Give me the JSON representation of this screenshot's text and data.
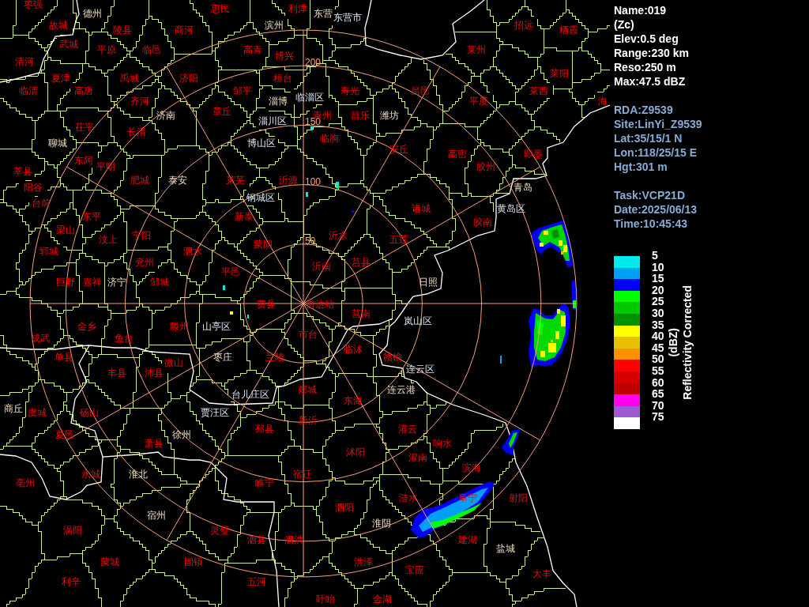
{
  "map": {
    "range_labels": [
      "200",
      "150",
      "100",
      "50"
    ],
    "places": [
      {
        "name": "枣强",
        "kind": "county"
      },
      {
        "name": "惠民",
        "kind": "county"
      },
      {
        "name": "利津",
        "kind": "county"
      },
      {
        "name": "德州",
        "kind": "city"
      },
      {
        "name": "东营",
        "kind": "city"
      },
      {
        "name": "东营市",
        "kind": "district"
      },
      {
        "name": "故城",
        "kind": "county"
      },
      {
        "name": "滨州",
        "kind": "city"
      },
      {
        "name": "招远",
        "kind": "county"
      },
      {
        "name": "陵县",
        "kind": "county"
      },
      {
        "name": "商河",
        "kind": "county"
      },
      {
        "name": "栖霞",
        "kind": "county"
      },
      {
        "name": "武城",
        "kind": "county"
      },
      {
        "name": "平原",
        "kind": "county"
      },
      {
        "name": "临邑",
        "kind": "county"
      },
      {
        "name": "高青",
        "kind": "county"
      },
      {
        "name": "莱州",
        "kind": "county"
      },
      {
        "name": "博兴",
        "kind": "county"
      },
      {
        "name": "清河",
        "kind": "county"
      },
      {
        "name": "莱阳",
        "kind": "county"
      },
      {
        "name": "夏津",
        "kind": "county"
      },
      {
        "name": "禹城",
        "kind": "county"
      },
      {
        "name": "济阳",
        "kind": "county"
      },
      {
        "name": "桓台",
        "kind": "county"
      },
      {
        "name": "临清",
        "kind": "county"
      },
      {
        "name": "高唐",
        "kind": "county"
      },
      {
        "name": "邹平",
        "kind": "county"
      },
      {
        "name": "寿光",
        "kind": "county"
      },
      {
        "name": "昌邑",
        "kind": "county"
      },
      {
        "name": "莱西",
        "kind": "county"
      },
      {
        "name": "临淄区",
        "kind": "district"
      },
      {
        "name": "齐河",
        "kind": "county"
      },
      {
        "name": "淄博",
        "kind": "city"
      },
      {
        "name": "平度",
        "kind": "county"
      },
      {
        "name": "海",
        "kind": "county"
      },
      {
        "name": "章丘",
        "kind": "county"
      },
      {
        "name": "济南",
        "kind": "city"
      },
      {
        "name": "青州",
        "kind": "county"
      },
      {
        "name": "昌乐",
        "kind": "county"
      },
      {
        "name": "潍坊",
        "kind": "city"
      },
      {
        "name": "淄川区",
        "kind": "district"
      },
      {
        "name": "茌平",
        "kind": "county"
      },
      {
        "name": "长清",
        "kind": "county"
      },
      {
        "name": "临朐",
        "kind": "county"
      },
      {
        "name": "聊城",
        "kind": "city"
      },
      {
        "name": "博山区",
        "kind": "district"
      },
      {
        "name": "安丘",
        "kind": "county"
      },
      {
        "name": "高密",
        "kind": "county"
      },
      {
        "name": "即墨",
        "kind": "county"
      },
      {
        "name": "东阿",
        "kind": "county"
      },
      {
        "name": "平阴",
        "kind": "county"
      },
      {
        "name": "胶州",
        "kind": "county"
      },
      {
        "name": "莘县",
        "kind": "county"
      },
      {
        "name": "肥城",
        "kind": "county"
      },
      {
        "name": "泰安",
        "kind": "city"
      },
      {
        "name": "莱芜",
        "kind": "county"
      },
      {
        "name": "沂源",
        "kind": "county"
      },
      {
        "name": "阳谷",
        "kind": "county"
      },
      {
        "name": "青岛",
        "kind": "city"
      },
      {
        "name": "钢城区",
        "kind": "district"
      },
      {
        "name": "台前",
        "kind": "county"
      },
      {
        "name": "诸城",
        "kind": "county"
      },
      {
        "name": "黄岛区",
        "kind": "district"
      },
      {
        "name": "东平",
        "kind": "county"
      },
      {
        "name": "新泰",
        "kind": "county"
      },
      {
        "name": "胶南",
        "kind": "county"
      },
      {
        "name": "梁山",
        "kind": "county"
      },
      {
        "name": "宁阳",
        "kind": "county"
      },
      {
        "name": "沂水",
        "kind": "county"
      },
      {
        "name": "汶上",
        "kind": "county"
      },
      {
        "name": "五莲",
        "kind": "county"
      },
      {
        "name": "蒙阴",
        "kind": "county"
      },
      {
        "name": "郓城",
        "kind": "county"
      },
      {
        "name": "泗水",
        "kind": "county"
      },
      {
        "name": "兖州",
        "kind": "county"
      },
      {
        "name": "莒县",
        "kind": "county"
      },
      {
        "name": "沂南",
        "kind": "county"
      },
      {
        "name": "平邑",
        "kind": "county"
      },
      {
        "name": "巨野",
        "kind": "county"
      },
      {
        "name": "嘉祥",
        "kind": "county"
      },
      {
        "name": "济宁",
        "kind": "city"
      },
      {
        "name": "邹城",
        "kind": "county"
      },
      {
        "name": "日照",
        "kind": "city"
      },
      {
        "name": "费县",
        "kind": "county"
      },
      {
        "name": "雷达站",
        "kind": "county"
      },
      {
        "name": "莒南",
        "kind": "county"
      },
      {
        "name": "岚山区",
        "kind": "district"
      },
      {
        "name": "金乡",
        "kind": "county"
      },
      {
        "name": "滕州",
        "kind": "county"
      },
      {
        "name": "山亭区",
        "kind": "district"
      },
      {
        "name": "市台",
        "kind": "county"
      },
      {
        "name": "成武",
        "kind": "county"
      },
      {
        "name": "鱼台",
        "kind": "county"
      },
      {
        "name": "临沭",
        "kind": "county"
      },
      {
        "name": "单县",
        "kind": "county"
      },
      {
        "name": "枣庄",
        "kind": "city"
      },
      {
        "name": "兰陵",
        "kind": "county"
      },
      {
        "name": "赣榆",
        "kind": "county"
      },
      {
        "name": "微山",
        "kind": "county"
      },
      {
        "name": "连云区",
        "kind": "district"
      },
      {
        "name": "丰县",
        "kind": "county"
      },
      {
        "name": "沛县",
        "kind": "county"
      },
      {
        "name": "郯城",
        "kind": "county"
      },
      {
        "name": "连云港",
        "kind": "city"
      },
      {
        "name": "台儿庄区",
        "kind": "district"
      },
      {
        "name": "东海",
        "kind": "county"
      },
      {
        "name": "商丘",
        "kind": "city"
      },
      {
        "name": "虞城",
        "kind": "county"
      },
      {
        "name": "砀山",
        "kind": "county"
      },
      {
        "name": "贾汪区",
        "kind": "district"
      },
      {
        "name": "新沂",
        "kind": "county"
      },
      {
        "name": "邳县",
        "kind": "county"
      },
      {
        "name": "灌云",
        "kind": "county"
      },
      {
        "name": "夏邑",
        "kind": "county"
      },
      {
        "name": "徐州",
        "kind": "city"
      },
      {
        "name": "萧县",
        "kind": "county"
      },
      {
        "name": "响水",
        "kind": "county"
      },
      {
        "name": "沭阳",
        "kind": "county"
      },
      {
        "name": "灌南",
        "kind": "county"
      },
      {
        "name": "滨海",
        "kind": "county"
      },
      {
        "name": "永城",
        "kind": "county"
      },
      {
        "name": "淮北",
        "kind": "city"
      },
      {
        "name": "宿迁",
        "kind": "county"
      },
      {
        "name": "亳州",
        "kind": "county"
      },
      {
        "name": "睢宁",
        "kind": "county"
      },
      {
        "name": "涟水",
        "kind": "county"
      },
      {
        "name": "阜宁",
        "kind": "county"
      },
      {
        "name": "射阳",
        "kind": "county"
      },
      {
        "name": "泗阳",
        "kind": "county"
      },
      {
        "name": "宿州",
        "kind": "city"
      },
      {
        "name": "淮阴",
        "kind": "city"
      },
      {
        "name": "涡阳",
        "kind": "county"
      },
      {
        "name": "灵璧",
        "kind": "county"
      },
      {
        "name": "泗县",
        "kind": "county"
      },
      {
        "name": "泗洪",
        "kind": "county"
      },
      {
        "name": "建湖",
        "kind": "county"
      },
      {
        "name": "盐城",
        "kind": "city"
      },
      {
        "name": "蒙城",
        "kind": "county"
      },
      {
        "name": "固镇",
        "kind": "county"
      },
      {
        "name": "洪泽",
        "kind": "county"
      },
      {
        "name": "宝应",
        "kind": "county"
      },
      {
        "name": "大丰",
        "kind": "county"
      },
      {
        "name": "利辛",
        "kind": "county"
      },
      {
        "name": "五河",
        "kind": "county"
      },
      {
        "name": "盱眙",
        "kind": "county"
      },
      {
        "name": "金湖",
        "kind": "county"
      }
    ]
  },
  "product": {
    "lines": [
      "Name:019",
      "(Zc)",
      "Elev:0.5 deg",
      "Range:230 km",
      "Reso:250 m",
      "Max:47.5 dBZ"
    ]
  },
  "station": {
    "lines": [
      "RDA:Z9539",
      "Site:LinYi_Z9539",
      "Lat:35/15/1 N",
      "Lon:118/25/15 E",
      "Hgt:301 m"
    ]
  },
  "scan": {
    "lines": [
      "Task:VCP21D",
      "Date:2025/06/13",
      "Time:10:45:43"
    ]
  },
  "legend": {
    "title": "Reflectivity Corrected",
    "unit": "(dBZ)",
    "items": [
      {
        "label": "5",
        "color": "#00ecec"
      },
      {
        "label": "10",
        "color": "#01a0f6"
      },
      {
        "label": "15",
        "color": "#0000f6"
      },
      {
        "label": "20",
        "color": "#00ff00"
      },
      {
        "label": "25",
        "color": "#00c800"
      },
      {
        "label": "30",
        "color": "#009000"
      },
      {
        "label": "35",
        "color": "#ffff00"
      },
      {
        "label": "40",
        "color": "#e7c000"
      },
      {
        "label": "45",
        "color": "#ff9000"
      },
      {
        "label": "50",
        "color": "#ff0000"
      },
      {
        "label": "55",
        "color": "#d60000"
      },
      {
        "label": "60",
        "color": "#c00000"
      },
      {
        "label": "65",
        "color": "#ff00f0"
      },
      {
        "label": "70",
        "color": "#9c5cd0"
      },
      {
        "label": "75",
        "color": "#ffffff"
      }
    ]
  }
}
